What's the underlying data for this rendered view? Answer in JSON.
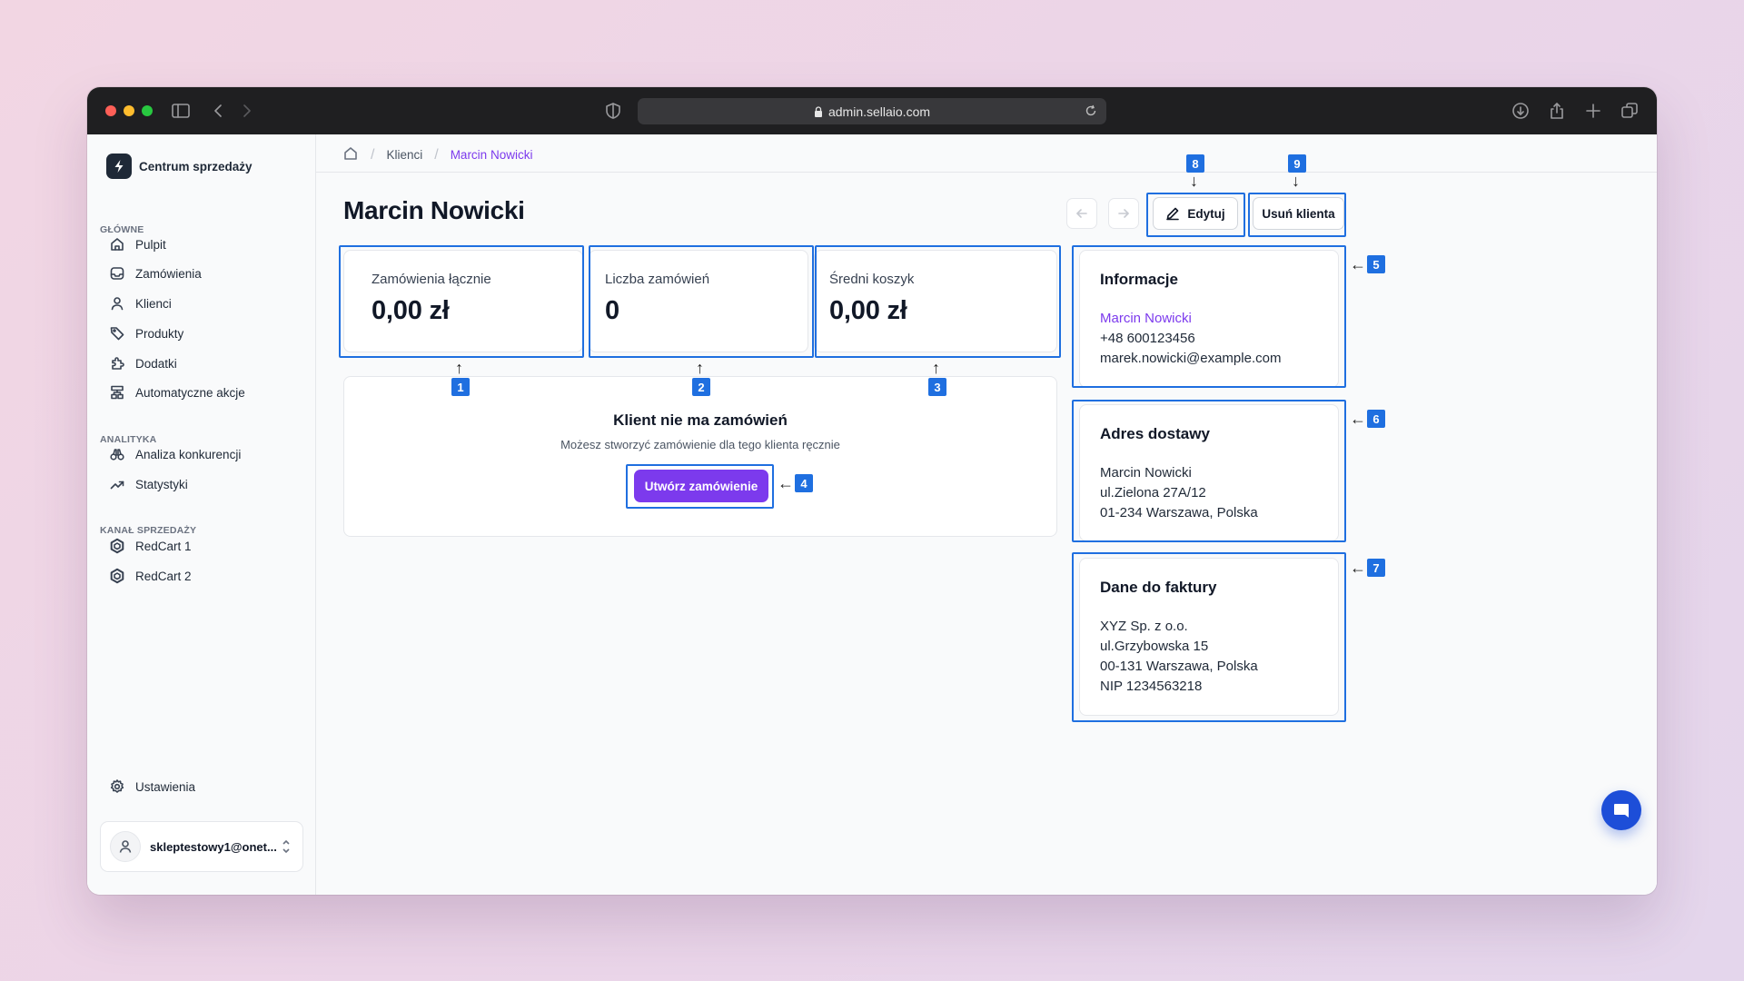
{
  "browser": {
    "url": "admin.sellaio.com"
  },
  "sidebar": {
    "brand": "Centrum sprzedaży",
    "sections": {
      "main": "GŁÓWNE",
      "analytics": "ANALITYKA",
      "channel": "KANAŁ SPRZEDAŻY"
    },
    "items": [
      {
        "label": "Pulpit",
        "icon": "home-icon"
      },
      {
        "label": "Zamówienia",
        "icon": "inbox-icon"
      },
      {
        "label": "Klienci",
        "icon": "user-icon"
      },
      {
        "label": "Produkty",
        "icon": "tag-icon"
      },
      {
        "label": "Dodatki",
        "icon": "puzzle-icon"
      },
      {
        "label": "Automatyczne akcje",
        "icon": "workflow-icon"
      },
      {
        "label": "Analiza konkurencji",
        "icon": "binoculars-icon"
      },
      {
        "label": "Statystyki",
        "icon": "trend-up-icon"
      },
      {
        "label": "RedCart 1",
        "icon": "hexagon-icon"
      },
      {
        "label": "RedCart 2",
        "icon": "hexagon-icon"
      }
    ],
    "settings": "Ustawienia",
    "user_email": "skleptestowy1@onet..."
  },
  "breadcrumb": {
    "items": [
      "Klienci",
      "Marcin Nowicki"
    ]
  },
  "page": {
    "title": "Marcin Nowicki",
    "edit_label": "Edytuj",
    "delete_label": "Usuń klienta"
  },
  "stats": [
    {
      "label": "Zamówienia łącznie",
      "value": "0,00 zł"
    },
    {
      "label": "Liczba zamówień",
      "value": "0"
    },
    {
      "label": "Średni koszyk",
      "value": "0,00 zł"
    }
  ],
  "empty_state": {
    "title": "Klient nie ma zamówień",
    "subtitle": "Możesz stworzyć zamówienie dla tego klienta ręcznie",
    "button": "Utwórz zamówienie"
  },
  "info": {
    "title": "Informacje",
    "name": "Marcin Nowicki",
    "phone": "+48 600123456",
    "email": "marek.nowicki@example.com"
  },
  "shipping": {
    "title": "Adres dostawy",
    "lines": [
      "Marcin Nowicki",
      "ul.Zielona 27A/12",
      "01-234 Warszawa, Polska"
    ]
  },
  "invoice": {
    "title": "Dane do faktury",
    "lines": [
      "XYZ Sp. z o.o.",
      "ul.Grzybowska 15",
      "00-131 Warszawa, Polska",
      "NIP 1234563218"
    ]
  },
  "annotations": [
    "1",
    "2",
    "3",
    "4",
    "5",
    "6",
    "7",
    "8",
    "9"
  ],
  "colors": {
    "accent": "#7c3aed",
    "annotation": "#1f6fe0",
    "chat": "#1d4ed8"
  }
}
